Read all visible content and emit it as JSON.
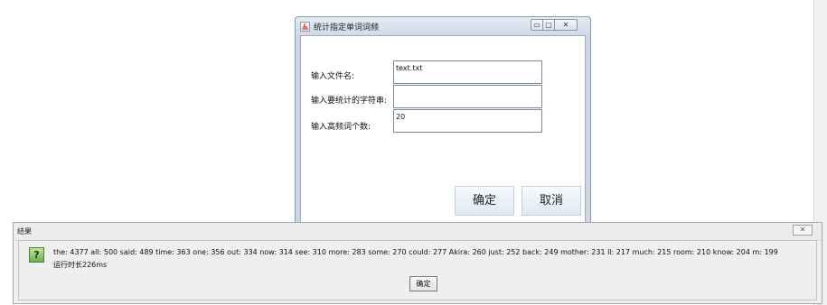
{
  "main_window": {
    "title": "统计指定单词词频",
    "controls": {
      "minimize": "▭",
      "maximize": "▢",
      "close": "✕"
    },
    "fields": [
      {
        "label": "输入文件名:",
        "value": "text.txt"
      },
      {
        "label": "输入要统计的字符串:",
        "value": ""
      },
      {
        "label": "输入高频词个数:",
        "value": "20"
      }
    ],
    "buttons": {
      "confirm": "确定",
      "cancel": "取消"
    }
  },
  "result_dialog": {
    "title": "结果",
    "close": "✕",
    "icon": "question-icon",
    "icon_glyph": "?",
    "message": "the: 4377   all: 500   said: 489   time: 363   one: 356   out: 334   now: 314   see: 310   more: 283   some: 270   could: 277   Akira: 260   just: 252   back: 249   mother: 231   ll: 217   much: 215   room: 210   know: 204   m: 199",
    "runtime": "运行时长226ms",
    "ok": "确定"
  },
  "colors": {
    "window_frame": "#c9d7e8",
    "question_icon": "#6fae4c"
  }
}
